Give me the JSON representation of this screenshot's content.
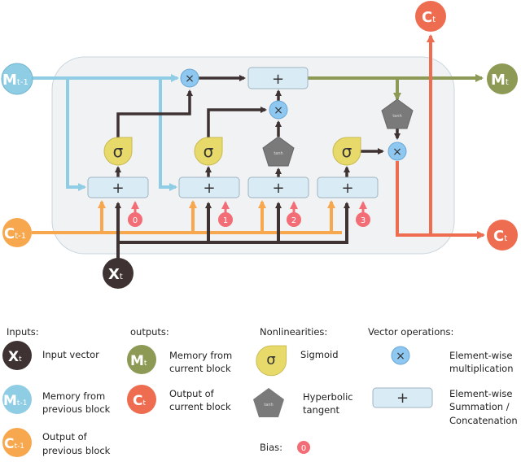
{
  "colors": {
    "background_box": "#f1f2f3",
    "box_border": "#9fb3c2",
    "memory_prev": "#8fcde4",
    "cell_prev": "#f7a84e",
    "input": "#3e3332",
    "memory_out": "#8c9a55",
    "cell_out": "#ee6d50",
    "sigmoid": "#e8d96b",
    "tanh": "#7a7a7a",
    "mult": "#8ec7ef",
    "sum": "#d9ebf4",
    "bias": "#f26d76",
    "arrow_dark": "#3e3332"
  },
  "nodes": {
    "m_prev": {
      "main": "M",
      "sub": "t-1"
    },
    "c_prev": {
      "main": "C",
      "sub": "t-1"
    },
    "x_t": {
      "main": "X",
      "sub": "t"
    },
    "m_t": {
      "main": "M",
      "sub": "t"
    },
    "c_t_top": {
      "main": "C",
      "sub": "t"
    },
    "c_t_right": {
      "main": "C",
      "sub": "t"
    }
  },
  "ops": {
    "mult_symbol": "×",
    "sum_symbol": "+",
    "sigmoid_symbol": "σ",
    "tanh_label": "tanh"
  },
  "biases": [
    "0",
    "1",
    "2",
    "3"
  ],
  "legend": {
    "inputs": {
      "heading": "Inputs:",
      "items": [
        {
          "main": "X",
          "sub": "t",
          "line1": "Input vector",
          "line2": ""
        },
        {
          "main": "M",
          "sub": "t-1",
          "line1": "Memory from",
          "line2": "previous block"
        },
        {
          "main": "C",
          "sub": "t-1",
          "line1": "Output of",
          "line2": "previous block"
        }
      ]
    },
    "outputs": {
      "heading": "outputs:",
      "items": [
        {
          "main": "M",
          "sub": "t",
          "line1": "Memory from",
          "line2": "current block"
        },
        {
          "main": "C",
          "sub": "t",
          "line1": "Output of",
          "line2": "current block"
        }
      ]
    },
    "nonlinearities": {
      "heading": "Nonlinearities:",
      "sigmoid": {
        "line1": "Sigmoid"
      },
      "tanh": {
        "line1": "Hyperbolic",
        "line2": "tangent"
      }
    },
    "vector_ops": {
      "heading": "Vector operations:",
      "mult": {
        "line1": "Element-wise",
        "line2": "multiplication"
      },
      "sum": {
        "line1": "Element-wise",
        "line2": "Summation /",
        "line3": "Concatenation"
      }
    },
    "bias": {
      "heading": "Bias:",
      "value": "0"
    }
  }
}
